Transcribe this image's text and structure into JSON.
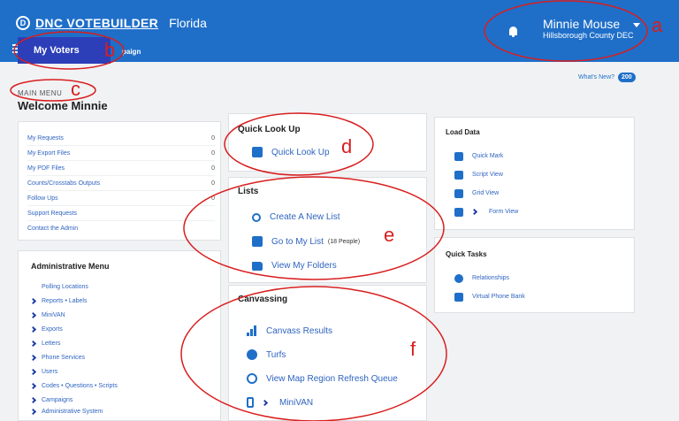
{
  "header": {
    "brand": "DNC VOTEBUILDER",
    "state": "Florida",
    "user_name": "Minnie Mouse",
    "user_org": "Hillsborough County DEC",
    "tabs": [
      "My Voters",
      "paign"
    ],
    "brand_color": "#1f6fc9",
    "active_tab_color": "#2c3fb8"
  },
  "whats_new": {
    "label": "What's New?",
    "count": "200"
  },
  "main_menu": "MAIN MENU",
  "welcome": "Welcome Minnie",
  "requests": [
    {
      "label": "My Requests",
      "count": "0"
    },
    {
      "label": "My Export Files",
      "count": "0"
    },
    {
      "label": "My PDF Files",
      "count": "0"
    },
    {
      "label": "Counts/Crosstabs Outputs",
      "count": "0"
    },
    {
      "label": "Follow Ups",
      "count": "0"
    },
    {
      "label": "Support Requests",
      "count": ""
    },
    {
      "label": "Contact the Admin",
      "count": ""
    }
  ],
  "admin": {
    "title": "Administrative Menu",
    "items": [
      "Polling Locations",
      "Reports • Labels",
      "MiniVAN",
      "Exports",
      "Letters",
      "Phone Services",
      "Users",
      "Codes • Questions • Scripts",
      "Campaigns",
      "Administrative System"
    ]
  },
  "quick_look": {
    "title": "Quick Look Up",
    "item": "Quick Look Up"
  },
  "lists": {
    "title": "Lists",
    "create": "Create A New List",
    "goto": "Go to My List",
    "goto_note": "(18 People)",
    "folders": "View My Folders"
  },
  "canvassing": {
    "title": "Canvassing",
    "items": [
      "Canvass Results",
      "Turfs",
      "View Map Region Refresh Queue",
      "MiniVAN"
    ]
  },
  "load_data": {
    "title": "Load Data",
    "items": [
      "Quick Mark",
      "Script View",
      "Grid View",
      "Form View"
    ]
  },
  "quick_tasks": {
    "title": "Quick Tasks",
    "items": [
      "Relationships",
      "Virtual Phone Bank"
    ]
  },
  "annotations": {
    "a": "a",
    "b": "b",
    "c": "c",
    "d": "d",
    "e": "e",
    "f": "f",
    "color": "#d81e1e"
  }
}
